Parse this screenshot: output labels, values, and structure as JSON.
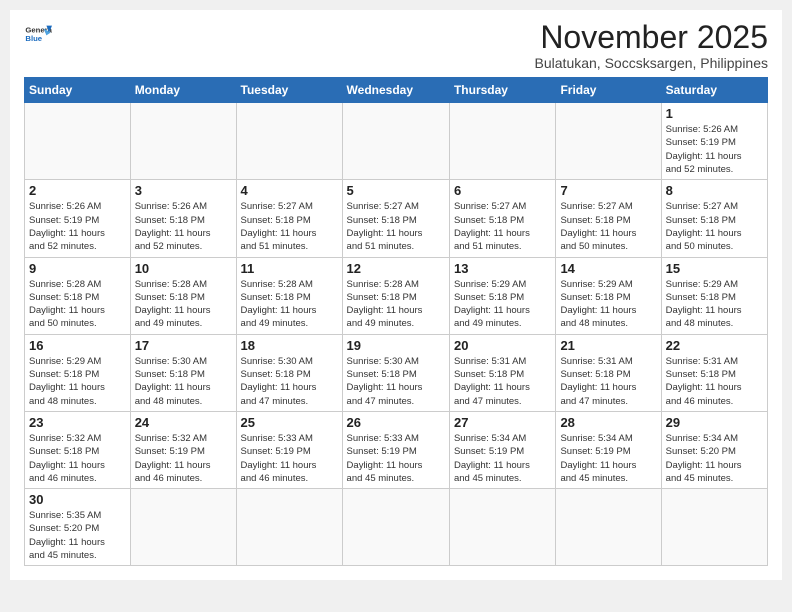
{
  "header": {
    "logo_line1": "General",
    "logo_line2": "Blue",
    "month": "November 2025",
    "location": "Bulatukan, Soccsksargen, Philippines"
  },
  "weekdays": [
    "Sunday",
    "Monday",
    "Tuesday",
    "Wednesday",
    "Thursday",
    "Friday",
    "Saturday"
  ],
  "weeks": [
    [
      {
        "day": "",
        "info": ""
      },
      {
        "day": "",
        "info": ""
      },
      {
        "day": "",
        "info": ""
      },
      {
        "day": "",
        "info": ""
      },
      {
        "day": "",
        "info": ""
      },
      {
        "day": "",
        "info": ""
      },
      {
        "day": "1",
        "info": "Sunrise: 5:26 AM\nSunset: 5:19 PM\nDaylight: 11 hours\nand 52 minutes."
      }
    ],
    [
      {
        "day": "2",
        "info": "Sunrise: 5:26 AM\nSunset: 5:19 PM\nDaylight: 11 hours\nand 52 minutes."
      },
      {
        "day": "3",
        "info": "Sunrise: 5:26 AM\nSunset: 5:18 PM\nDaylight: 11 hours\nand 52 minutes."
      },
      {
        "day": "4",
        "info": "Sunrise: 5:27 AM\nSunset: 5:18 PM\nDaylight: 11 hours\nand 51 minutes."
      },
      {
        "day": "5",
        "info": "Sunrise: 5:27 AM\nSunset: 5:18 PM\nDaylight: 11 hours\nand 51 minutes."
      },
      {
        "day": "6",
        "info": "Sunrise: 5:27 AM\nSunset: 5:18 PM\nDaylight: 11 hours\nand 51 minutes."
      },
      {
        "day": "7",
        "info": "Sunrise: 5:27 AM\nSunset: 5:18 PM\nDaylight: 11 hours\nand 50 minutes."
      },
      {
        "day": "8",
        "info": "Sunrise: 5:27 AM\nSunset: 5:18 PM\nDaylight: 11 hours\nand 50 minutes."
      }
    ],
    [
      {
        "day": "9",
        "info": "Sunrise: 5:28 AM\nSunset: 5:18 PM\nDaylight: 11 hours\nand 50 minutes."
      },
      {
        "day": "10",
        "info": "Sunrise: 5:28 AM\nSunset: 5:18 PM\nDaylight: 11 hours\nand 49 minutes."
      },
      {
        "day": "11",
        "info": "Sunrise: 5:28 AM\nSunset: 5:18 PM\nDaylight: 11 hours\nand 49 minutes."
      },
      {
        "day": "12",
        "info": "Sunrise: 5:28 AM\nSunset: 5:18 PM\nDaylight: 11 hours\nand 49 minutes."
      },
      {
        "day": "13",
        "info": "Sunrise: 5:29 AM\nSunset: 5:18 PM\nDaylight: 11 hours\nand 49 minutes."
      },
      {
        "day": "14",
        "info": "Sunrise: 5:29 AM\nSunset: 5:18 PM\nDaylight: 11 hours\nand 48 minutes."
      },
      {
        "day": "15",
        "info": "Sunrise: 5:29 AM\nSunset: 5:18 PM\nDaylight: 11 hours\nand 48 minutes."
      }
    ],
    [
      {
        "day": "16",
        "info": "Sunrise: 5:29 AM\nSunset: 5:18 PM\nDaylight: 11 hours\nand 48 minutes."
      },
      {
        "day": "17",
        "info": "Sunrise: 5:30 AM\nSunset: 5:18 PM\nDaylight: 11 hours\nand 48 minutes."
      },
      {
        "day": "18",
        "info": "Sunrise: 5:30 AM\nSunset: 5:18 PM\nDaylight: 11 hours\nand 47 minutes."
      },
      {
        "day": "19",
        "info": "Sunrise: 5:30 AM\nSunset: 5:18 PM\nDaylight: 11 hours\nand 47 minutes."
      },
      {
        "day": "20",
        "info": "Sunrise: 5:31 AM\nSunset: 5:18 PM\nDaylight: 11 hours\nand 47 minutes."
      },
      {
        "day": "21",
        "info": "Sunrise: 5:31 AM\nSunset: 5:18 PM\nDaylight: 11 hours\nand 47 minutes."
      },
      {
        "day": "22",
        "info": "Sunrise: 5:31 AM\nSunset: 5:18 PM\nDaylight: 11 hours\nand 46 minutes."
      }
    ],
    [
      {
        "day": "23",
        "info": "Sunrise: 5:32 AM\nSunset: 5:18 PM\nDaylight: 11 hours\nand 46 minutes."
      },
      {
        "day": "24",
        "info": "Sunrise: 5:32 AM\nSunset: 5:19 PM\nDaylight: 11 hours\nand 46 minutes."
      },
      {
        "day": "25",
        "info": "Sunrise: 5:33 AM\nSunset: 5:19 PM\nDaylight: 11 hours\nand 46 minutes."
      },
      {
        "day": "26",
        "info": "Sunrise: 5:33 AM\nSunset: 5:19 PM\nDaylight: 11 hours\nand 45 minutes."
      },
      {
        "day": "27",
        "info": "Sunrise: 5:34 AM\nSunset: 5:19 PM\nDaylight: 11 hours\nand 45 minutes."
      },
      {
        "day": "28",
        "info": "Sunrise: 5:34 AM\nSunset: 5:19 PM\nDaylight: 11 hours\nand 45 minutes."
      },
      {
        "day": "29",
        "info": "Sunrise: 5:34 AM\nSunset: 5:20 PM\nDaylight: 11 hours\nand 45 minutes."
      }
    ],
    [
      {
        "day": "30",
        "info": "Sunrise: 5:35 AM\nSunset: 5:20 PM\nDaylight: 11 hours\nand 45 minutes."
      },
      {
        "day": "",
        "info": ""
      },
      {
        "day": "",
        "info": ""
      },
      {
        "day": "",
        "info": ""
      },
      {
        "day": "",
        "info": ""
      },
      {
        "day": "",
        "info": ""
      },
      {
        "day": "",
        "info": ""
      }
    ]
  ]
}
